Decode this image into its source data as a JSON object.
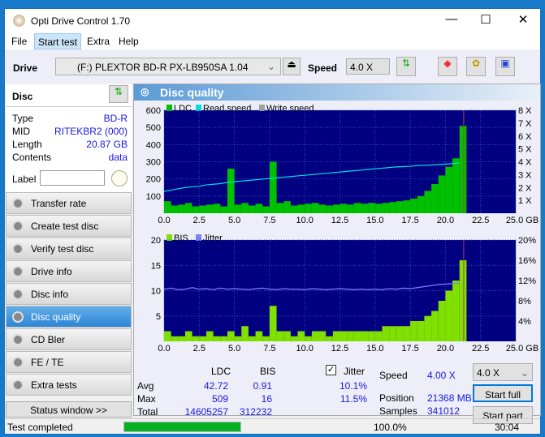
{
  "window": {
    "title": "Opti Drive Control 1.70",
    "minimize": "—",
    "maximize": "☐",
    "close": "✕"
  },
  "menu": [
    "File",
    "Start test",
    "Extra",
    "Help"
  ],
  "toolbar": {
    "drive_label": "Drive",
    "drive_value": "(F:)   PLEXTOR BD-R  PX-LB950SA 1.04",
    "speed_label": "Speed",
    "speed_value": "4.0 X"
  },
  "disc": {
    "header": "Disc",
    "rows": [
      {
        "k": "Type",
        "v": "BD-R"
      },
      {
        "k": "MID",
        "v": "RITEKBR2 (000)"
      },
      {
        "k": "Length",
        "v": "20.87 GB"
      },
      {
        "k": "Contents",
        "v": "data"
      }
    ],
    "label_label": "Label",
    "label_value": ""
  },
  "sidebar": {
    "items": [
      "Transfer rate",
      "Create test disc",
      "Verify test disc",
      "Drive info",
      "Disc info",
      "Disc quality",
      "CD Bler",
      "FE / TE",
      "Extra tests"
    ],
    "active": 5,
    "status_window": "Status window >>"
  },
  "panel": {
    "title": "Disc quality"
  },
  "chart_data": [
    {
      "type": "bar",
      "legend": [
        "LDC",
        "Read speed",
        "Write speed"
      ],
      "colors": {
        "LDC": "#00c000",
        "Read speed": "#00e0e0",
        "Write speed": "#a0a0a0"
      },
      "xlim": [
        0,
        25
      ],
      "ylim": [
        0,
        600
      ],
      "y2lim": [
        0,
        8
      ],
      "xticks": [
        "0.0",
        "2.5",
        "5.0",
        "7.5",
        "10.0",
        "12.5",
        "15.0",
        "17.5",
        "20.0",
        "22.5",
        "25.0 GB"
      ],
      "yticks": [
        "100",
        "200",
        "300",
        "400",
        "500",
        "600"
      ],
      "y2ticks": [
        "1 X",
        "2 X",
        "3 X",
        "4 X",
        "5 X",
        "6 X",
        "7 X",
        "8 X"
      ],
      "x": [
        0,
        0.5,
        1,
        1.5,
        2,
        2.5,
        3,
        3.5,
        4,
        4.5,
        5,
        5.5,
        6,
        6.5,
        7,
        7.5,
        8,
        8.5,
        9,
        9.5,
        10,
        10.5,
        11,
        11.5,
        12,
        12.5,
        13,
        13.5,
        14,
        14.5,
        15,
        15.5,
        16,
        16.5,
        17,
        17.5,
        18,
        18.5,
        19,
        19.5,
        20,
        20.5,
        21
      ],
      "ldc": [
        70,
        45,
        50,
        60,
        40,
        45,
        50,
        55,
        40,
        260,
        50,
        60,
        45,
        55,
        40,
        300,
        60,
        70,
        45,
        50,
        55,
        60,
        50,
        45,
        50,
        55,
        50,
        60,
        55,
        60,
        55,
        60,
        65,
        70,
        75,
        85,
        100,
        130,
        170,
        220,
        270,
        320,
        509
      ],
      "read_speed": [
        1.7,
        1.8,
        1.9,
        2.0,
        2.05,
        2.1,
        2.2,
        2.25,
        2.3,
        2.4,
        2.45,
        2.5,
        2.55,
        2.6,
        2.65,
        2.7,
        2.75,
        2.8,
        2.85,
        2.9,
        2.95,
        3.0,
        3.05,
        3.1,
        3.15,
        3.2,
        3.25,
        3.3,
        3.35,
        3.4,
        3.45,
        3.5,
        3.55,
        3.6,
        3.62,
        3.65,
        3.7,
        3.72,
        3.75,
        3.78,
        3.82,
        3.85,
        3.9
      ]
    },
    {
      "type": "bar",
      "legend": [
        "BIS",
        "Jitter"
      ],
      "colors": {
        "BIS": "#80e000",
        "Jitter": "#8080ff"
      },
      "xlim": [
        0,
        25
      ],
      "ylim": [
        0,
        20
      ],
      "y2lim": [
        0,
        20
      ],
      "xticks": [
        "0.0",
        "2.5",
        "5.0",
        "7.5",
        "10.0",
        "12.5",
        "15.0",
        "17.5",
        "20.0",
        "22.5",
        "25.0 GB"
      ],
      "yticks": [
        "5",
        "10",
        "15",
        "20"
      ],
      "y2ticks": [
        "4%",
        "8%",
        "12%",
        "16%",
        "20%"
      ],
      "x": [
        0,
        0.5,
        1,
        1.5,
        2,
        2.5,
        3,
        3.5,
        4,
        4.5,
        5,
        5.5,
        6,
        6.5,
        7,
        7.5,
        8,
        8.5,
        9,
        9.5,
        10,
        10.5,
        11,
        11.5,
        12,
        12.5,
        13,
        13.5,
        14,
        14.5,
        15,
        15.5,
        16,
        16.5,
        17,
        17.5,
        18,
        18.5,
        19,
        19.5,
        20,
        20.5,
        21
      ],
      "bis": [
        2,
        1,
        1,
        2,
        1,
        1,
        2,
        1,
        1,
        2,
        1,
        3,
        1,
        2,
        1,
        7,
        2,
        2,
        1,
        2,
        1,
        2,
        2,
        1,
        2,
        2,
        2,
        2,
        2,
        2,
        2,
        3,
        3,
        3,
        3,
        4,
        4,
        5,
        6,
        8,
        10,
        12,
        16
      ],
      "jitter": [
        10.3,
        10.5,
        10.2,
        10.3,
        10.6,
        10.3,
        10.4,
        10.2,
        10.5,
        10.3,
        10.4,
        10.3,
        10.2,
        10.4,
        10.5,
        10.3,
        10.2,
        10.4,
        10.3,
        10.3,
        10.2,
        10.4,
        10.3,
        10.2,
        10.3,
        10.4,
        10.3,
        10.2,
        10.3,
        10.2,
        10.3,
        10.2,
        10.4,
        10.3,
        10.5,
        10.4,
        10.6,
        10.8,
        11.0,
        11.2,
        11.3,
        11.4,
        11.5
      ]
    }
  ],
  "stats": {
    "col_ldc": "LDC",
    "col_bis": "BIS",
    "jitter_label": "Jitter",
    "jitter_checked": true,
    "rows": [
      {
        "k": "Avg",
        "ldc": "42.72",
        "bis": "0.91",
        "jit": "10.1%"
      },
      {
        "k": "Max",
        "ldc": "509",
        "bis": "16",
        "jit": "11.5%"
      },
      {
        "k": "Total",
        "ldc": "14605257",
        "bis": "312232",
        "jit": ""
      }
    ],
    "speed_label": "Speed",
    "speed_value": "4.00 X",
    "position_label": "Position",
    "position_value": "21368 MB",
    "samples_label": "Samples",
    "samples_value": "341012",
    "speed_select": "4.0 X",
    "start_full": "Start full",
    "start_part": "Start part"
  },
  "status": {
    "text": "Test completed",
    "progress": 100,
    "progress_text": "100.0%",
    "time": "30:04"
  }
}
